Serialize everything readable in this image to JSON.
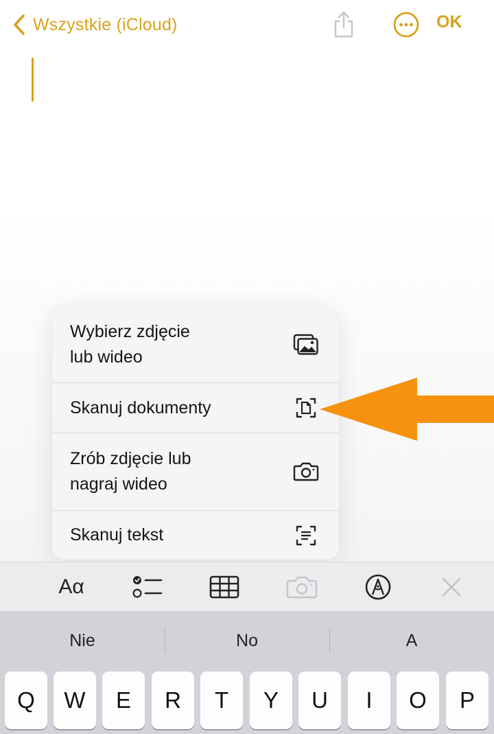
{
  "nav": {
    "back_label": "Wszystkie (iCloud)",
    "done_label": "OK"
  },
  "menu": {
    "items": [
      {
        "label": "Wybierz zdjęcie\nlub wideo",
        "icon": "photo-library-icon"
      },
      {
        "label": "Skanuj dokumenty",
        "icon": "document-scan-icon"
      },
      {
        "label": "Zrób zdjęcie lub\nnagraj wideo",
        "icon": "camera-icon"
      },
      {
        "label": "Skanuj tekst",
        "icon": "text-scan-icon"
      }
    ]
  },
  "toolbar": {
    "format_label": "Aα",
    "icons": [
      "format-icon",
      "checklist-icon",
      "table-icon",
      "camera-icon",
      "markup-icon",
      "close-icon"
    ]
  },
  "keyboard": {
    "suggestions": [
      "Nie",
      "No",
      "A"
    ],
    "row1": [
      "Q",
      "W",
      "E",
      "R",
      "T",
      "Y",
      "U",
      "I",
      "O",
      "P"
    ]
  },
  "colors": {
    "accent": "#d9a11a",
    "annotation_arrow": "#f7920f",
    "menu_background": "#f5f5f6",
    "keyboard_background": "#d1d3d9",
    "toolbar_background": "#ececef",
    "disabled_icon": "#c4c4c8"
  }
}
